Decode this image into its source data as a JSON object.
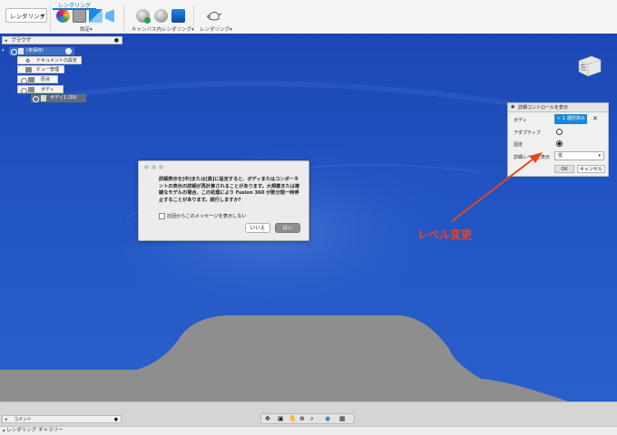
{
  "toolbar": {
    "mode_label": "レンダリング",
    "active_tab": "レンダリング",
    "group_settings": "設定",
    "group_canvas_render": "キャンバス内レンダリング",
    "group_render": "レンダリング"
  },
  "browser": {
    "title": "ブラウザ",
    "root_label": "(未保存)",
    "items": {
      "doc_settings": "ドキュメントの設定",
      "named_views": "ビュー管理",
      "origin": "原点",
      "bodies": "ボディ",
      "body1": "ボディ1 (39)"
    }
  },
  "viewcube_label": "左",
  "detail_panel": {
    "title": "詳細コントロールを表示",
    "rows": {
      "body_label": "ボディ",
      "body_value": "1 選択済み",
      "adaptive_label": "アダプティブ",
      "fixed_label": "固定",
      "level_label": "詳細レベルを表示",
      "level_value": "低"
    },
    "ok": "OK",
    "cancel": "キャンセル"
  },
  "annotation": {
    "text": "レベル変更",
    "color": "#e8431f"
  },
  "dialog": {
    "message": "詳細表示を[中]または[高]に設定すると、ボディまたはコンポーネントの表示の詳細が再計算されることがあります。大規模または複雑なモデルの場合、この処理により Fusion 360 が数分間一時停止することがあります。続行しますか?",
    "checkbox_label": "次回からこのメッセージを表示しない",
    "no_button": "いいえ",
    "yes_button": "はい"
  },
  "bottom": {
    "comment_label": "コメント",
    "gallery_label": "レンダリング ギャラリー"
  },
  "colors": {
    "model_blue": "#1e4fbf",
    "accent": "#1a73c9"
  }
}
